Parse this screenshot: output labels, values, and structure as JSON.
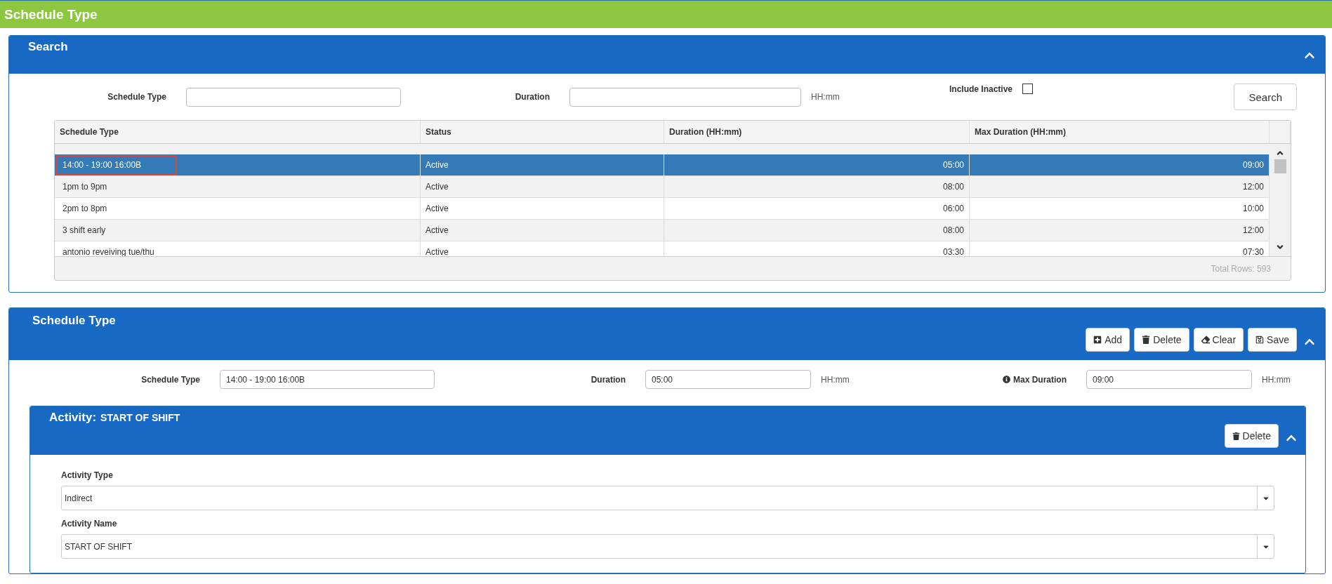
{
  "page_title": "Schedule Type",
  "search_panel": {
    "title": "Search",
    "fields": [
      {
        "label": "Schedule Type"
      },
      {
        "label": "Duration",
        "unit": "HH:mm"
      }
    ],
    "include_inactive": {
      "label": "Include Inactive",
      "checked": false
    },
    "search_button": "Search",
    "table": {
      "columns": [
        "Schedule Type",
        "Status",
        "Duration (HH:mm)",
        "Max Duration (HH:mm)"
      ],
      "rows": [
        {
          "cells": [
            "14:00 - 19:00 16:00B",
            "Active",
            "05:00",
            "09:00"
          ],
          "selected": true,
          "focused": true
        },
        {
          "cells": [
            "1pm to 9pm",
            "Active",
            "08:00",
            "12:00"
          ],
          "selected": false,
          "focused": false
        },
        {
          "cells": [
            "2pm to 8pm",
            "Active",
            "06:00",
            "10:00"
          ],
          "selected": false,
          "focused": false
        },
        {
          "cells": [
            "3 shift early",
            "Active",
            "08:00",
            "12:00"
          ],
          "selected": false,
          "focused": false
        },
        {
          "cells": [
            "antonio reveiving tue/thu",
            "Active",
            "03:30",
            "07:30"
          ],
          "selected": false,
          "focused": false
        }
      ],
      "total": "Total Rows: 593"
    }
  },
  "editor_panel": {
    "title": "Schedule Type",
    "buttons": [
      {
        "kind": "add",
        "label": "Add"
      },
      {
        "kind": "delete",
        "label": "Delete"
      },
      {
        "kind": "clear",
        "label": "Clear"
      },
      {
        "kind": "save",
        "label": "Save"
      }
    ],
    "fields": [
      {
        "label": "Schedule Type",
        "value": "14:00 - 19:00 16:00B"
      },
      {
        "label": "Duration",
        "value": "05:00",
        "unit": "HH:mm"
      },
      {
        "label": "Max Duration",
        "value": "09:00",
        "unit": "HH:mm",
        "info": true
      }
    ],
    "activity": {
      "prefix": "Activity:",
      "name": "START OF SHIFT",
      "delete_button": "Delete",
      "selects": [
        {
          "label": "Activity Type",
          "value": "Indirect"
        },
        {
          "label": "Activity Name",
          "value": "START OF SHIFT"
        }
      ]
    }
  }
}
